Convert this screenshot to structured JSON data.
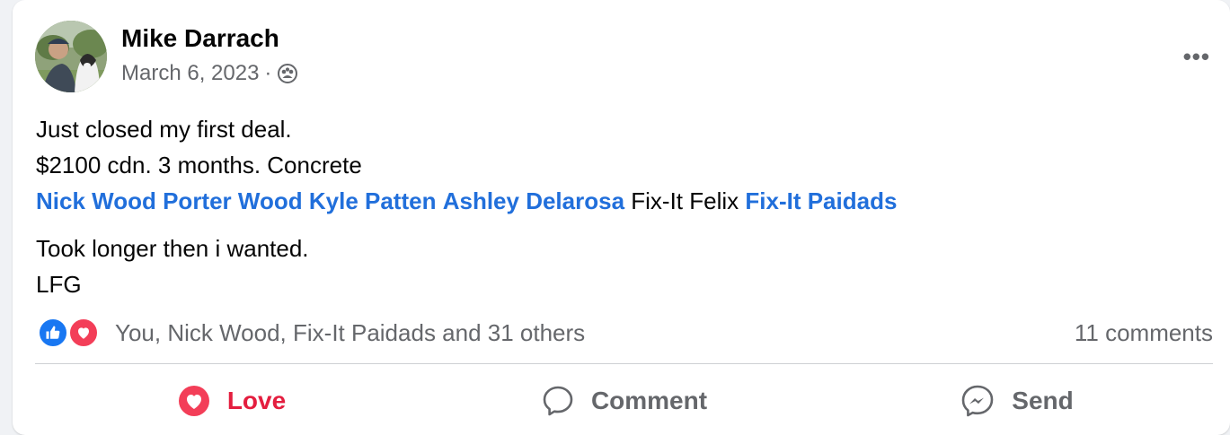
{
  "post": {
    "author": "Mike Darrach",
    "date": "March 6, 2023",
    "separator": "·",
    "audience_icon": "friends-icon",
    "more_icon": "more-options-icon",
    "more_label": "•••",
    "lines": {
      "line1": "Just closed my first deal.",
      "line2": "$2100 cdn. 3 months. Concrete",
      "line5": "Took longer then i wanted.",
      "line6": "LFG"
    },
    "mentions": {
      "m1": "Nick Wood",
      "m2": "Porter Wood",
      "m3": "Kyle Patten",
      "m4": "Ashley Delarosa",
      "plain": "Fix-It Felix",
      "m5": "Fix-It Paidads"
    }
  },
  "reactions": {
    "icons": [
      "like-icon",
      "love-icon"
    ],
    "summary": "You, Nick Wood, Fix-It Paidads and 31 others",
    "comments": "11 comments"
  },
  "actions": {
    "love": "Love",
    "comment": "Comment",
    "send": "Send"
  },
  "colors": {
    "mention": "#216fdb",
    "love": "#e41e3f",
    "like": "#1877f2",
    "secondary": "#65676b"
  }
}
